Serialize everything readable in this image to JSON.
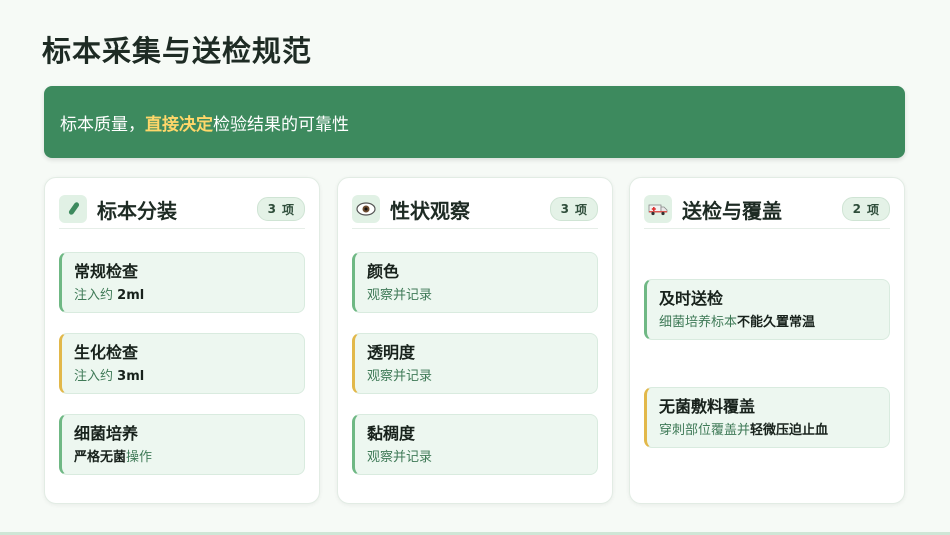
{
  "page": {
    "title": "标本采集与送检规范"
  },
  "banner": {
    "prefix": "标本质量，",
    "highlight": "直接决定",
    "suffix": "检验结果的可靠性"
  },
  "colors": {
    "primary": "#3d8a5e",
    "highlight": "#ffd76a",
    "accent_yellow": "#e2b84a"
  },
  "cards": [
    {
      "icon": "test-tube-icon",
      "title": "标本分装",
      "badge_count": "3",
      "badge_unit": "项",
      "items": [
        {
          "title": "常规检查",
          "desc_pre": "注入约",
          "desc_bold": "2ml",
          "desc_post": ""
        },
        {
          "title": "生化检查",
          "desc_pre": "注入约",
          "desc_bold": "3ml",
          "desc_post": ""
        },
        {
          "title": "细菌培养",
          "desc_pre": "",
          "desc_bold": "严格无菌",
          "desc_post": "操作"
        }
      ]
    },
    {
      "icon": "eye-icon",
      "title": "性状观察",
      "badge_count": "3",
      "badge_unit": "项",
      "items": [
        {
          "title": "颜色",
          "desc_pre": "观察并记录",
          "desc_bold": "",
          "desc_post": ""
        },
        {
          "title": "透明度",
          "desc_pre": "观察并记录",
          "desc_bold": "",
          "desc_post": ""
        },
        {
          "title": "黏稠度",
          "desc_pre": "观察并记录",
          "desc_bold": "",
          "desc_post": ""
        }
      ]
    },
    {
      "icon": "ambulance-icon",
      "title": "送检与覆盖",
      "badge_count": "2",
      "badge_unit": "项",
      "items": [
        {
          "title": "及时送检",
          "desc_pre": "细菌培养标本",
          "desc_bold": "不能久置常温",
          "desc_post": ""
        },
        {
          "title": "无菌敷料覆盖",
          "desc_pre": "穿刺部位覆盖并",
          "desc_bold": "轻微压迫止血",
          "desc_post": ""
        }
      ]
    }
  ]
}
